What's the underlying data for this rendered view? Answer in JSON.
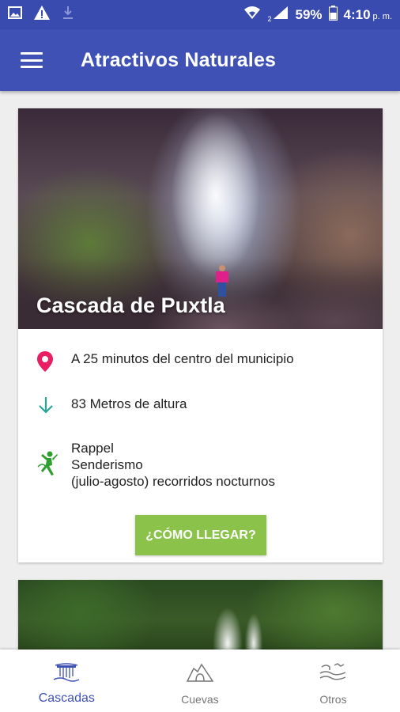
{
  "status_bar": {
    "battery": "59%",
    "time": "4:10",
    "time_suffix": "p. m.",
    "sim_indicator": "2",
    "icons": [
      "image-icon",
      "warning-icon",
      "download-icon",
      "wifi-icon",
      "signal-icon",
      "battery-icon"
    ]
  },
  "app_bar": {
    "title": "Atractivos Naturales",
    "menu_icon": "hamburger-menu-icon",
    "color": "#3f51b5"
  },
  "card": {
    "title": "Cascada de Puxtla",
    "location_text": "A 25 minutos del centro del municipio",
    "location_icon": "location-pin-icon",
    "location_icon_color": "#e91e63",
    "height_text": "83 Metros de altura",
    "height_icon": "arrow-down-icon",
    "height_icon_color": "#26a69a",
    "activity_icon": "climbing-icon",
    "activity_icon_color": "#2e9e2e",
    "activities": [
      "Rappel",
      "Senderismo",
      "(julio-agosto) recorridos nocturnos"
    ],
    "button_label": "¿CÓMO LLEGAR?",
    "button_color": "#8bc34a"
  },
  "bottom_nav": {
    "items": [
      {
        "label": "Cascadas",
        "icon": "waterfall-icon",
        "active": true
      },
      {
        "label": "Cuevas",
        "icon": "cave-icon",
        "active": false
      },
      {
        "label": "Otros",
        "icon": "river-icon",
        "active": false
      }
    ],
    "active_color": "#3f51b5"
  }
}
